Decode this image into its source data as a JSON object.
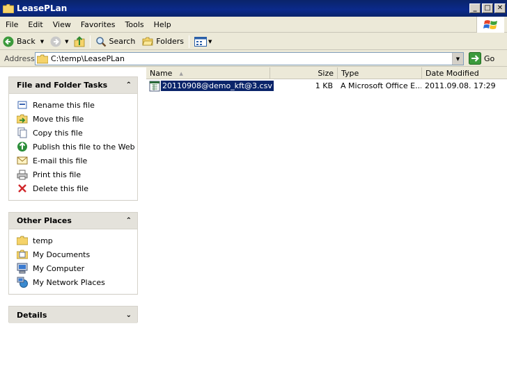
{
  "window": {
    "title": "LeasePLan",
    "minimize": "_",
    "maximize": "□",
    "close": "✕"
  },
  "menu": {
    "items": [
      "File",
      "Edit",
      "View",
      "Favorites",
      "Tools",
      "Help"
    ]
  },
  "toolbar": {
    "back_label": "Back",
    "search_label": "Search",
    "folders_label": "Folders"
  },
  "address": {
    "label": "Address",
    "value": "C:\\temp\\LeasePLan",
    "go_label": "Go"
  },
  "tasks_panel": {
    "title": "File and Folder Tasks",
    "items": [
      {
        "label": "Rename this file",
        "icon": "rename-icon"
      },
      {
        "label": "Move this file",
        "icon": "move-icon"
      },
      {
        "label": "Copy this file",
        "icon": "copy-icon"
      },
      {
        "label": "Publish this file to the Web",
        "icon": "publish-web-icon"
      },
      {
        "label": "E-mail this file",
        "icon": "email-icon"
      },
      {
        "label": "Print this file",
        "icon": "print-icon"
      },
      {
        "label": "Delete this file",
        "icon": "delete-icon"
      }
    ]
  },
  "places_panel": {
    "title": "Other Places",
    "items": [
      {
        "label": "temp",
        "icon": "folder-icon"
      },
      {
        "label": "My Documents",
        "icon": "my-documents-icon"
      },
      {
        "label": "My Computer",
        "icon": "my-computer-icon"
      },
      {
        "label": "My Network Places",
        "icon": "network-places-icon"
      }
    ]
  },
  "details_panel": {
    "title": "Details"
  },
  "file_list": {
    "columns": {
      "name": "Name",
      "size": "Size",
      "type": "Type",
      "date": "Date Modified"
    },
    "files": [
      {
        "name": "20110908@demo_kft@3.csv",
        "size": "1 KB",
        "type": "A Microsoft Office E...",
        "date": "2011.09.08. 17:29",
        "selected": true
      }
    ]
  },
  "colors": {
    "title_bar": "#0a246a",
    "selection": "#0a246a",
    "chrome": "#ece9d8"
  }
}
